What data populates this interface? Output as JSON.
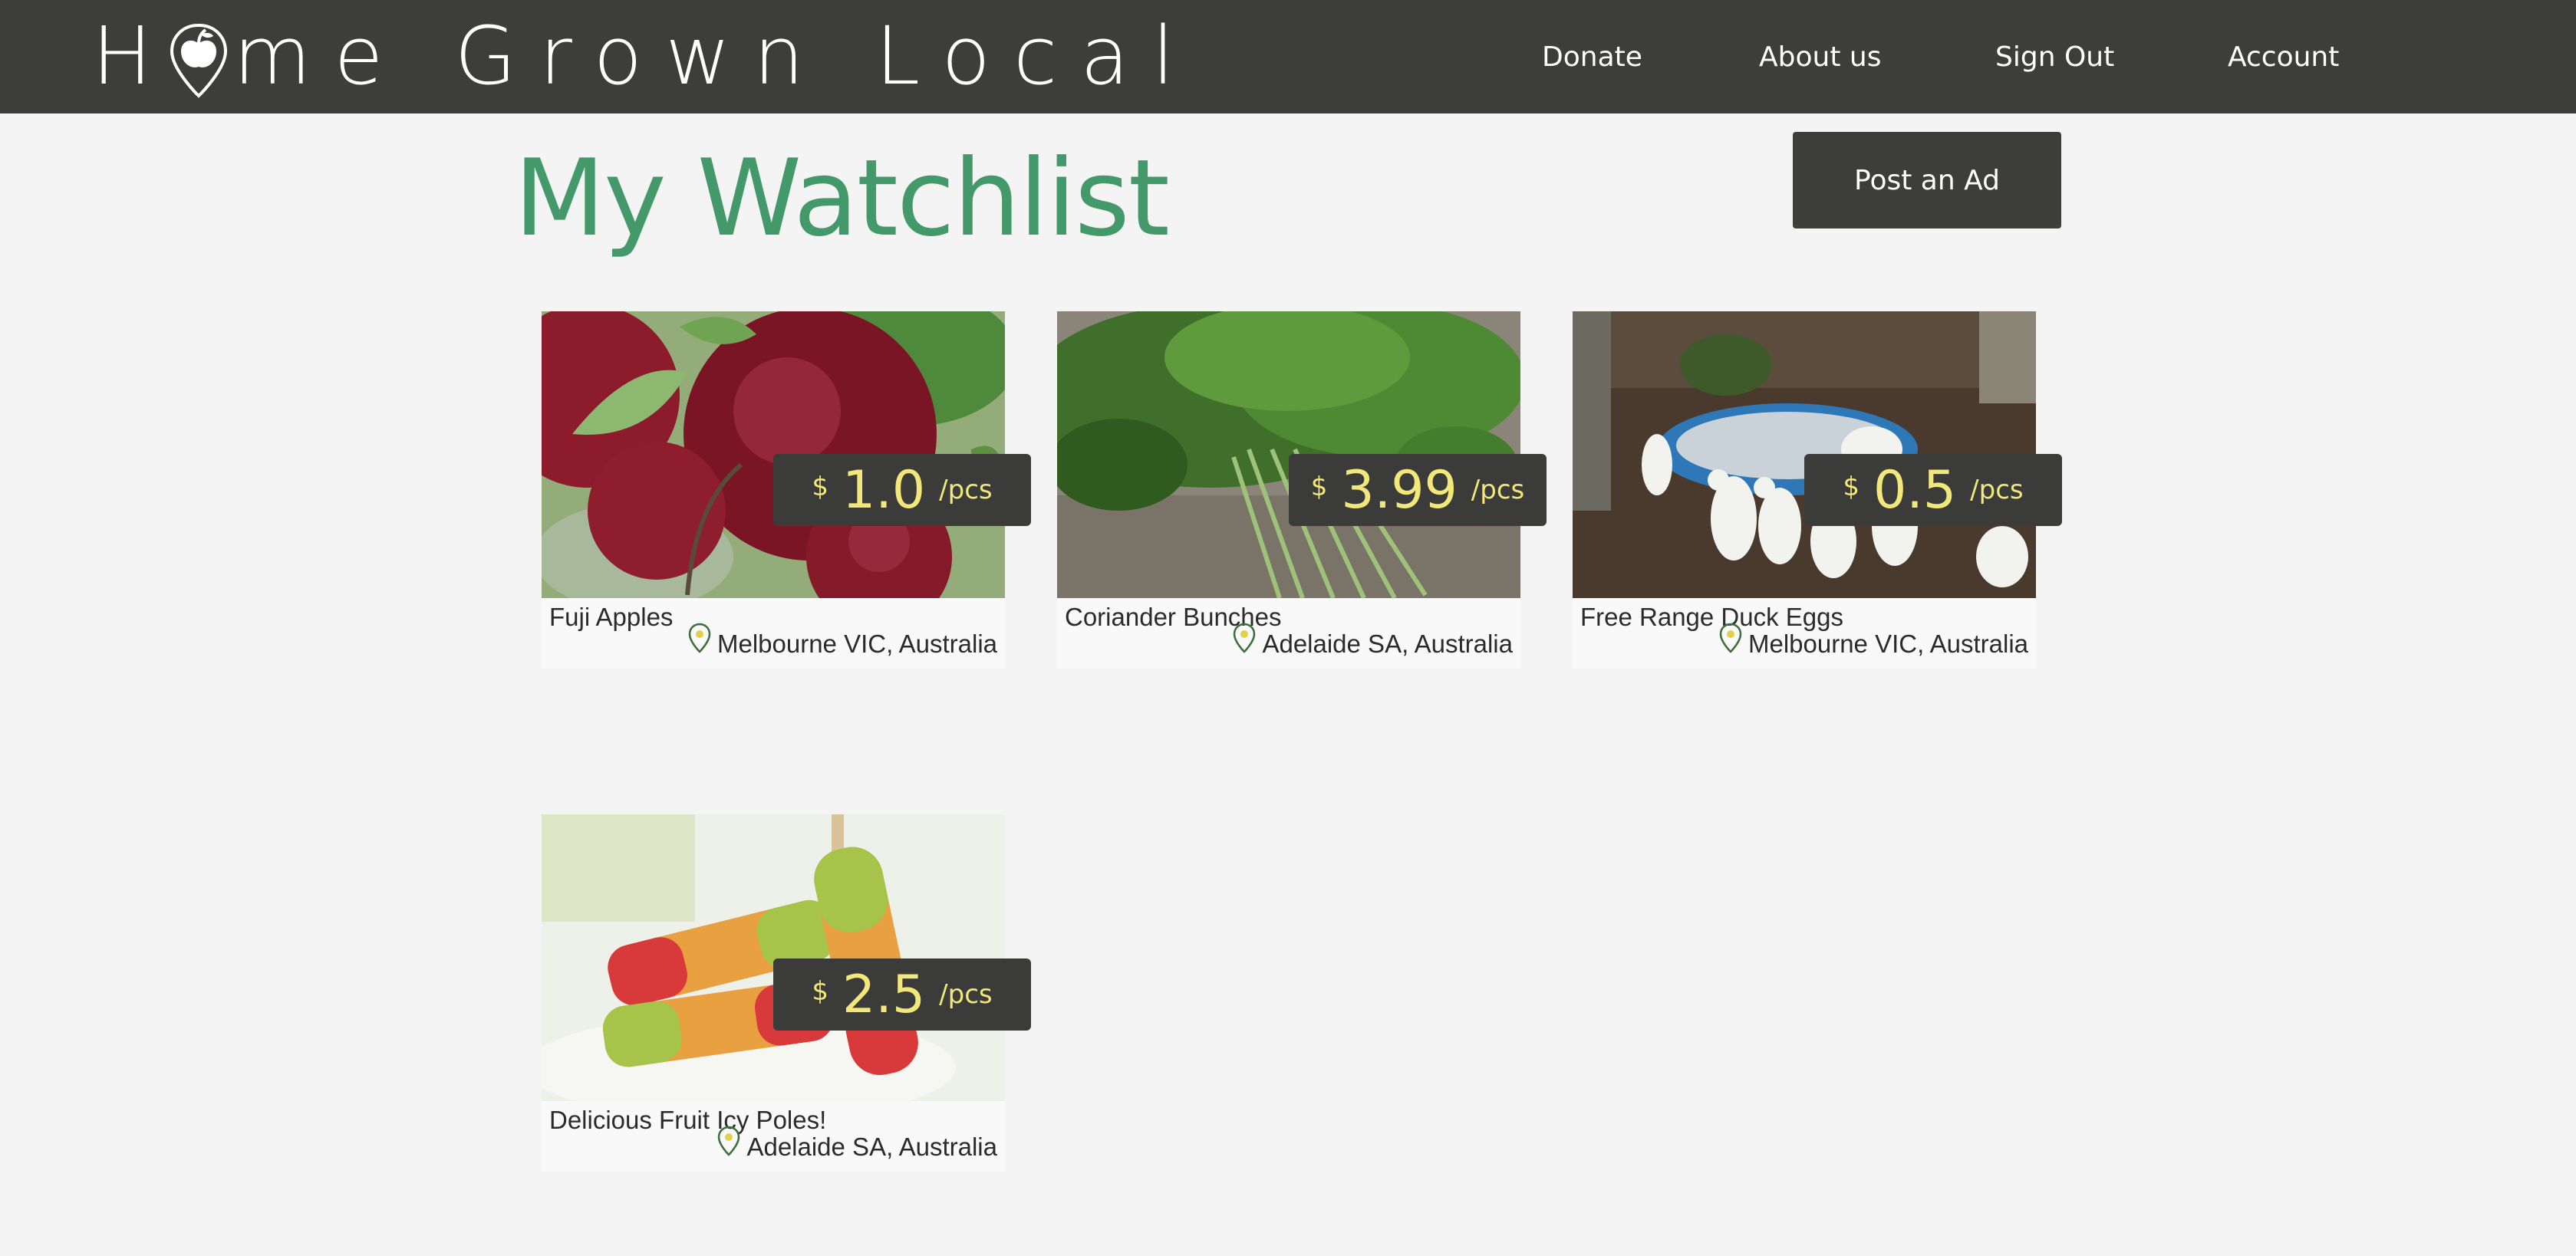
{
  "brand": {
    "name_before": "H",
    "name_after": "me Grown Local"
  },
  "nav": {
    "donate": "Donate",
    "about": "About us",
    "signout": "Sign Out",
    "account": "Account"
  },
  "page": {
    "title": "My Watchlist",
    "post_ad": "Post an Ad"
  },
  "colors": {
    "topbar": "#3d3e3c",
    "title": "#44996a",
    "price_text": "#f1e77a",
    "price_bg": "#3b3b3a"
  },
  "listings": [
    {
      "name": "Fuji Apples",
      "location": "Melbourne VIC, Australia",
      "currency": "$",
      "price": "1.0",
      "unit": "/pcs",
      "image": "apples-photo"
    },
    {
      "name": "Coriander Bunches",
      "location": "Adelaide SA, Australia",
      "currency": "$",
      "price": "3.99",
      "unit": "/pcs",
      "image": "coriander-photo"
    },
    {
      "name": "Free Range Duck Eggs",
      "location": "Melbourne VIC, Australia",
      "currency": "$",
      "price": "0.5",
      "unit": "/pcs",
      "image": "ducks-photo"
    },
    {
      "name": "Delicious Fruit Icy Poles!",
      "location": "Adelaide SA, Australia",
      "currency": "$",
      "price": "2.5",
      "unit": "/pcs",
      "image": "icy-poles-photo"
    }
  ]
}
